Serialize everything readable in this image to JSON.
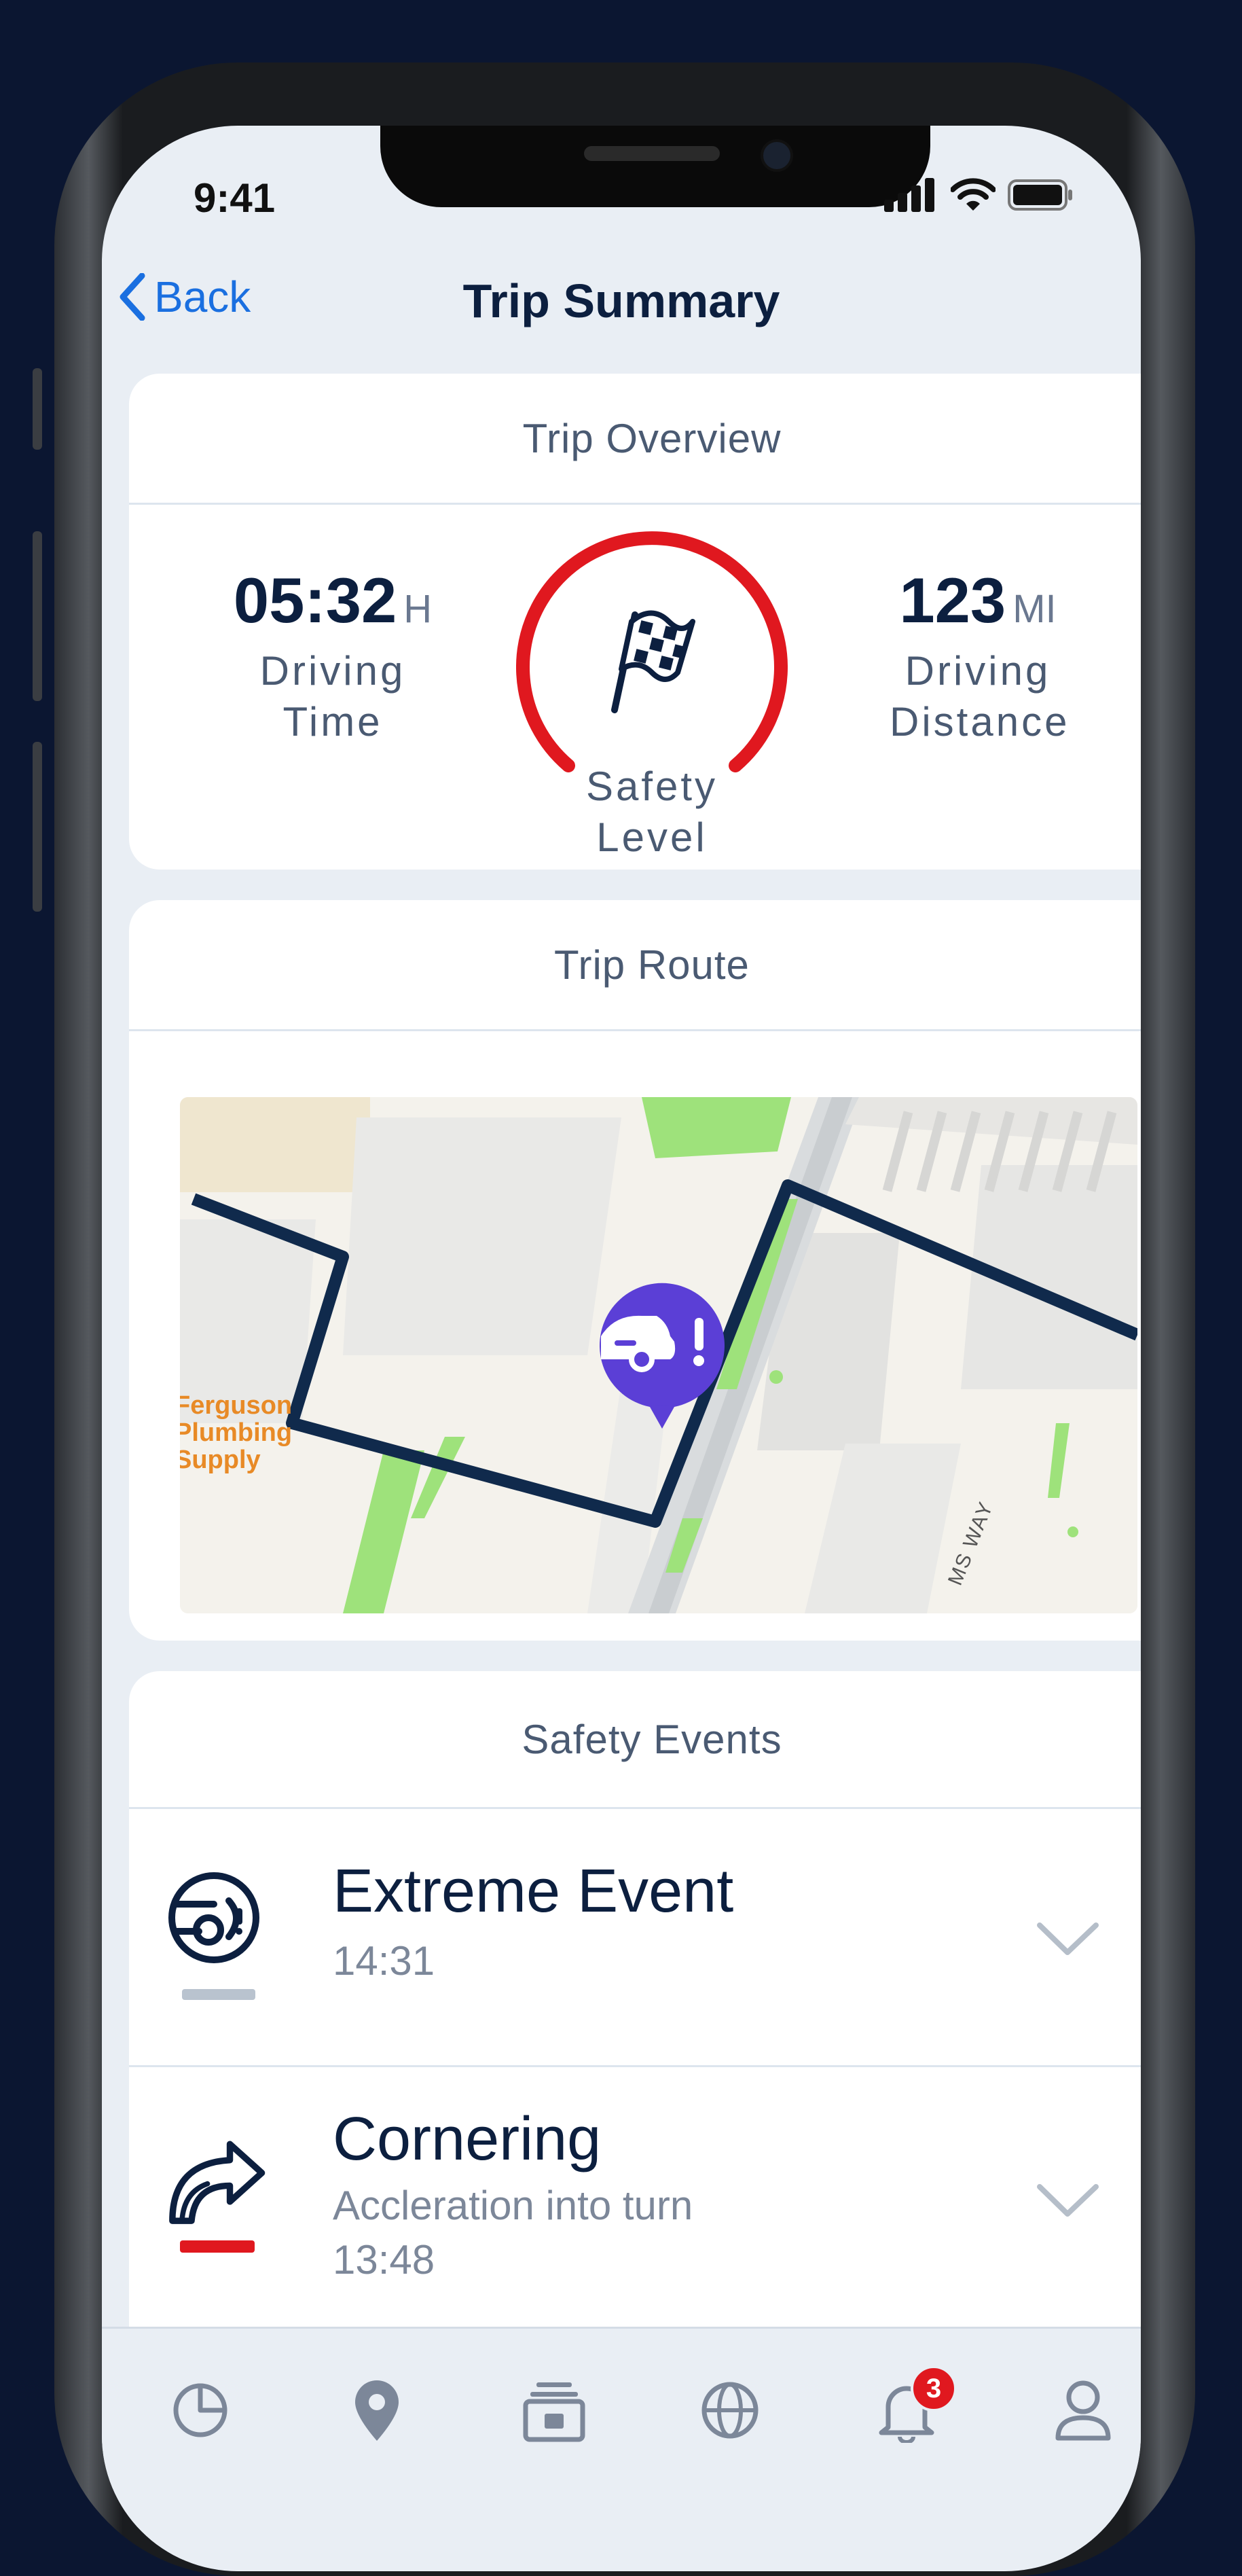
{
  "status_bar": {
    "time": "9:41",
    "icons": [
      "signal-icon",
      "wifi-icon",
      "battery-icon"
    ]
  },
  "nav": {
    "back_label": "Back",
    "title": "Trip Summary"
  },
  "overview": {
    "header": "Trip Overview",
    "driving_time": {
      "value": "05:32",
      "unit": "H",
      "label": "Driving Time"
    },
    "safety": {
      "label": "Safety Level",
      "icon": "checkered-flag-icon",
      "color": "#e0181f"
    },
    "driving_distance": {
      "value": "123",
      "unit": "MI",
      "label": "Driving Distance"
    }
  },
  "route": {
    "header": "Trip Route",
    "map_label": "Ferguson Plumbing Supply",
    "street_label": "MS WAY",
    "route_color": "#102a4c",
    "marker_color": "#5b3fd6"
  },
  "events": {
    "header": "Safety Events",
    "items": [
      {
        "title": "Extreme Event",
        "lines": [
          "14:31"
        ],
        "icon": "extreme-event-icon",
        "bar_color": "#b9c3cf"
      },
      {
        "title": "Cornering",
        "lines": [
          "Accleration into turn",
          "13:48"
        ],
        "icon": "cornering-icon",
        "bar_color": "#e0181f"
      }
    ]
  },
  "tabbar": {
    "items": [
      "dashboard-icon",
      "location-icon",
      "license-icon",
      "globe-icon",
      "notifications-icon",
      "profile-icon"
    ],
    "notification_count": "3"
  }
}
